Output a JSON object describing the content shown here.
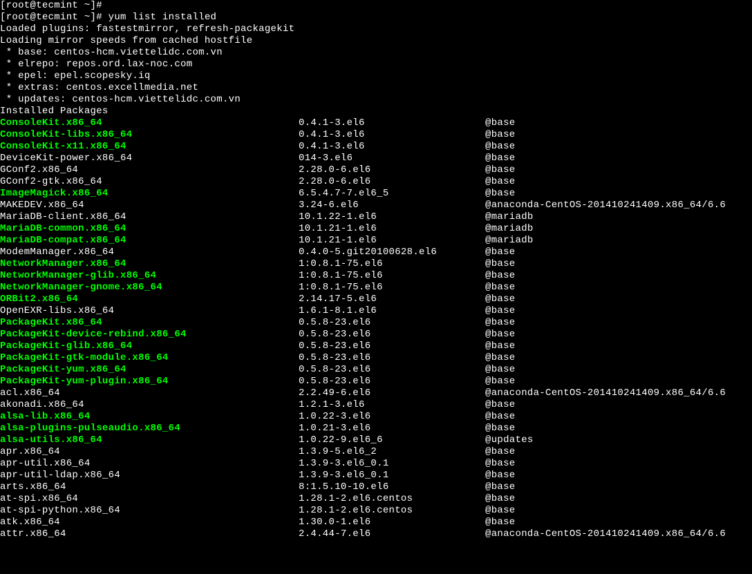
{
  "prompt_empty": "[root@tecmint ~]# ",
  "prompt_cmd": "[root@tecmint ~]# yum list installed",
  "header_lines": [
    "Loaded plugins: fastestmirror, refresh-packagekit",
    "Loading mirror speeds from cached hostfile",
    " * base: centos-hcm.viettelidc.com.vn",
    " * elrepo: repos.ord.lax-noc.com",
    " * epel: epel.scopesky.iq",
    " * extras: centos.excellmedia.net",
    " * updates: centos-hcm.viettelidc.com.vn",
    "Installed Packages"
  ],
  "packages": [
    {
      "name": "ConsoleKit.x86_64",
      "ver": "0.4.1-3.el6",
      "repo": "@base",
      "hl": true
    },
    {
      "name": "ConsoleKit-libs.x86_64",
      "ver": "0.4.1-3.el6",
      "repo": "@base",
      "hl": true
    },
    {
      "name": "ConsoleKit-x11.x86_64",
      "ver": "0.4.1-3.el6",
      "repo": "@base",
      "hl": true
    },
    {
      "name": "DeviceKit-power.x86_64",
      "ver": "014-3.el6",
      "repo": "@base",
      "hl": false
    },
    {
      "name": "GConf2.x86_64",
      "ver": "2.28.0-6.el6",
      "repo": "@base",
      "hl": false
    },
    {
      "name": "GConf2-gtk.x86_64",
      "ver": "2.28.0-6.el6",
      "repo": "@base",
      "hl": false
    },
    {
      "name": "ImageMagick.x86_64",
      "ver": "6.5.4.7-7.el6_5",
      "repo": "@base",
      "hl": true
    },
    {
      "name": "MAKEDEV.x86_64",
      "ver": "3.24-6.el6",
      "repo": "@anaconda-CentOS-201410241409.x86_64/6.6",
      "hl": false
    },
    {
      "name": "MariaDB-client.x86_64",
      "ver": "10.1.22-1.el6",
      "repo": "@mariadb",
      "hl": false
    },
    {
      "name": "MariaDB-common.x86_64",
      "ver": "10.1.21-1.el6",
      "repo": "@mariadb",
      "hl": true
    },
    {
      "name": "MariaDB-compat.x86_64",
      "ver": "10.1.21-1.el6",
      "repo": "@mariadb",
      "hl": true
    },
    {
      "name": "ModemManager.x86_64",
      "ver": "0.4.0-5.git20100628.el6",
      "repo": "@base",
      "hl": false
    },
    {
      "name": "NetworkManager.x86_64",
      "ver": "1:0.8.1-75.el6",
      "repo": "@base",
      "hl": true
    },
    {
      "name": "NetworkManager-glib.x86_64",
      "ver": "1:0.8.1-75.el6",
      "repo": "@base",
      "hl": true
    },
    {
      "name": "NetworkManager-gnome.x86_64",
      "ver": "1:0.8.1-75.el6",
      "repo": "@base",
      "hl": true
    },
    {
      "name": "ORBit2.x86_64",
      "ver": "2.14.17-5.el6",
      "repo": "@base",
      "hl": true
    },
    {
      "name": "OpenEXR-libs.x86_64",
      "ver": "1.6.1-8.1.el6",
      "repo": "@base",
      "hl": false
    },
    {
      "name": "PackageKit.x86_64",
      "ver": "0.5.8-23.el6",
      "repo": "@base",
      "hl": true
    },
    {
      "name": "PackageKit-device-rebind.x86_64",
      "ver": "0.5.8-23.el6",
      "repo": "@base",
      "hl": true
    },
    {
      "name": "PackageKit-glib.x86_64",
      "ver": "0.5.8-23.el6",
      "repo": "@base",
      "hl": true
    },
    {
      "name": "PackageKit-gtk-module.x86_64",
      "ver": "0.5.8-23.el6",
      "repo": "@base",
      "hl": true
    },
    {
      "name": "PackageKit-yum.x86_64",
      "ver": "0.5.8-23.el6",
      "repo": "@base",
      "hl": true
    },
    {
      "name": "PackageKit-yum-plugin.x86_64",
      "ver": "0.5.8-23.el6",
      "repo": "@base",
      "hl": true
    },
    {
      "name": "acl.x86_64",
      "ver": "2.2.49-6.el6",
      "repo": "@anaconda-CentOS-201410241409.x86_64/6.6",
      "hl": false
    },
    {
      "name": "akonadi.x86_64",
      "ver": "1.2.1-3.el6",
      "repo": "@base",
      "hl": false
    },
    {
      "name": "alsa-lib.x86_64",
      "ver": "1.0.22-3.el6",
      "repo": "@base",
      "hl": true
    },
    {
      "name": "alsa-plugins-pulseaudio.x86_64",
      "ver": "1.0.21-3.el6",
      "repo": "@base",
      "hl": true
    },
    {
      "name": "alsa-utils.x86_64",
      "ver": "1.0.22-9.el6_6",
      "repo": "@updates",
      "hl": true
    },
    {
      "name": "apr.x86_64",
      "ver": "1.3.9-5.el6_2",
      "repo": "@base",
      "hl": false
    },
    {
      "name": "apr-util.x86_64",
      "ver": "1.3.9-3.el6_0.1",
      "repo": "@base",
      "hl": false
    },
    {
      "name": "apr-util-ldap.x86_64",
      "ver": "1.3.9-3.el6_0.1",
      "repo": "@base",
      "hl": false
    },
    {
      "name": "arts.x86_64",
      "ver": "8:1.5.10-10.el6",
      "repo": "@base",
      "hl": false
    },
    {
      "name": "at-spi.x86_64",
      "ver": "1.28.1-2.el6.centos",
      "repo": "@base",
      "hl": false
    },
    {
      "name": "at-spi-python.x86_64",
      "ver": "1.28.1-2.el6.centos",
      "repo": "@base",
      "hl": false
    },
    {
      "name": "atk.x86_64",
      "ver": "1.30.0-1.el6",
      "repo": "@base",
      "hl": false
    },
    {
      "name": "attr.x86_64",
      "ver": "2.4.44-7.el6",
      "repo": "@anaconda-CentOS-201410241409.x86_64/6.6",
      "hl": false
    }
  ]
}
